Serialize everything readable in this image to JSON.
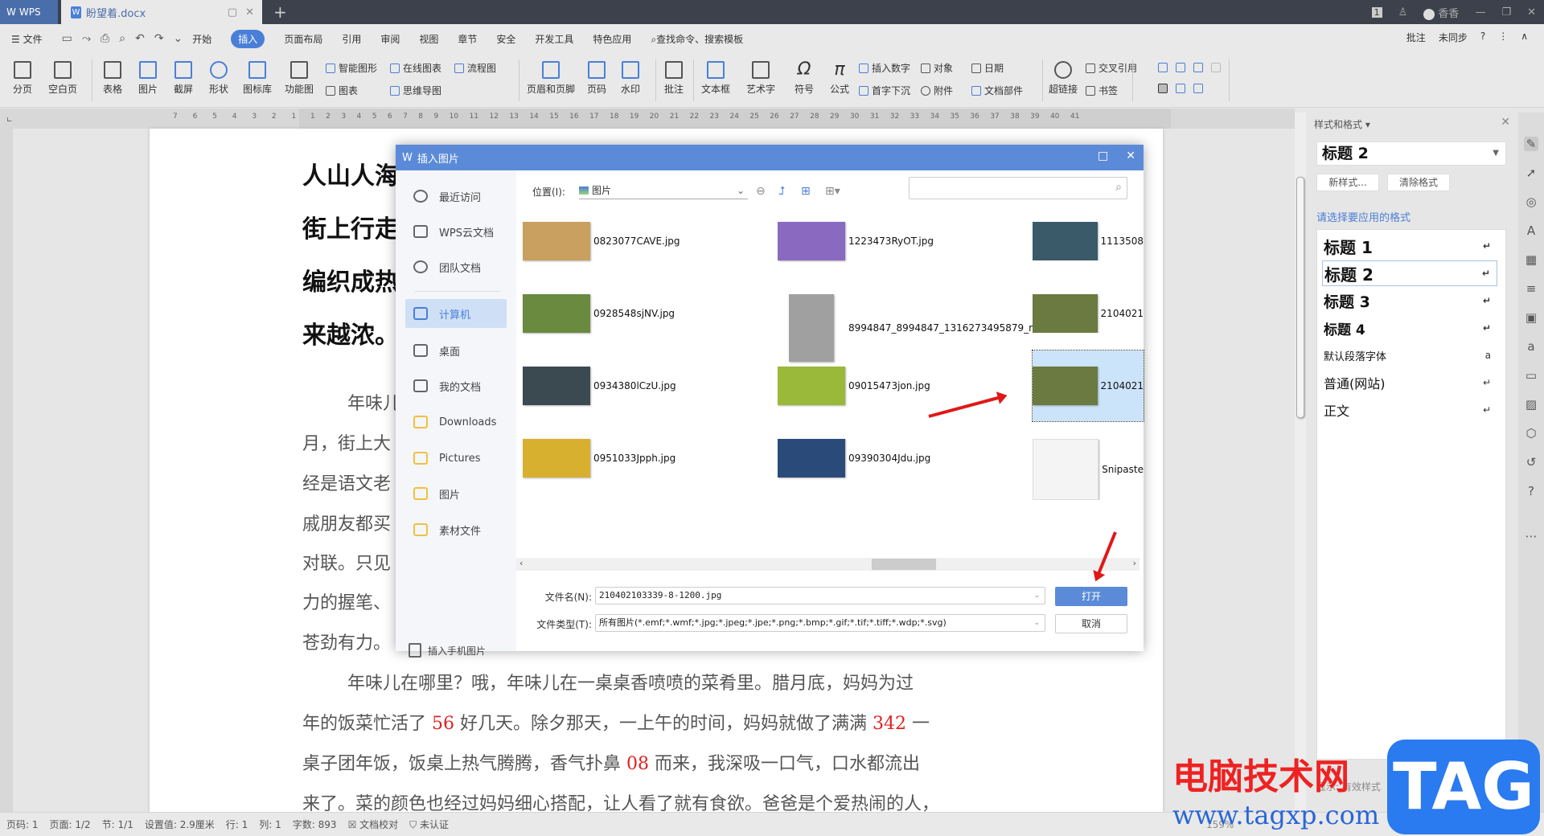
{
  "titlebar": {
    "app_label": "WPS",
    "doc_tab": "盼望着.docx",
    "user_name": "香香",
    "badge": "1"
  },
  "menubar": {
    "file": "文件",
    "tabs": [
      "开始",
      "插入",
      "页面布局",
      "引用",
      "审阅",
      "视图",
      "章节",
      "安全",
      "开发工具",
      "特色应用"
    ],
    "active_tab": "插入",
    "search": "查找命令、搜索模板",
    "right": [
      "批注",
      "未同步",
      "?"
    ]
  },
  "ribbon": {
    "large": [
      "分页",
      "空白页",
      "表格",
      "图片",
      "截屏",
      "形状",
      "图标库",
      "功能图",
      "页眉和页脚",
      "页码",
      "水印",
      "批注",
      "文本框",
      "艺术字",
      "符号",
      "公式",
      "超链接"
    ],
    "small": [
      "智能图形",
      "在线图表",
      "流程图",
      "图表",
      "思维导图",
      "插入数字",
      "对象",
      "日期",
      "首字下沉",
      "附件",
      "文档部件",
      "交叉引用",
      "书签"
    ]
  },
  "ruler": {
    "left_numbers": [
      "7",
      "6",
      "5",
      "4",
      "3",
      "2",
      "1"
    ],
    "right_numbers": [
      "1",
      "2",
      "3",
      "4",
      "5",
      "6",
      "7",
      "8",
      "9",
      "10",
      "11",
      "12",
      "13",
      "14",
      "15",
      "16",
      "17",
      "18",
      "19",
      "20",
      "21",
      "22",
      "23",
      "24",
      "25",
      "26",
      "27",
      "28",
      "29",
      "30",
      "31",
      "32",
      "33",
      "34",
      "35",
      "36",
      "37",
      "38",
      "39",
      "40",
      "41"
    ]
  },
  "document": {
    "headings": [
      "人山人海",
      "街上行走",
      "编织成热",
      "来越浓。"
    ],
    "body_partial": [
      "年味儿",
      "月，街上大",
      "经是语文老",
      "戚朋友都买",
      "对联。只见",
      "力的握笔、",
      "苍劲有力。"
    ],
    "para2": [
      {
        "text": "年味儿在哪里？哦，年味儿在一桌桌香喷喷的菜肴里。腊月底，妈妈为过"
      },
      {
        "pre": "年的饭菜忙活了 ",
        "n1": "56",
        "mid": " 好几天。除夕那天，一上午的时间，妈妈就做了满满 ",
        "n2": "342",
        "post": " 一"
      },
      {
        "pre": "桌子团年饭，饭桌上热气腾腾，香气扑鼻 ",
        "n1": "08",
        "post": " 而来，我深吸一口气，口水都流出"
      },
      {
        "text": "来了。菜的颜色也经过妈妈细心搭配，让人看了就有食欲。爸爸是个爱热闹的人，"
      }
    ]
  },
  "dialog": {
    "title": "插入图片",
    "nav": [
      "最近访问",
      "WPS云文档",
      "团队文档",
      "计算机",
      "桌面",
      "我的文档",
      "Downloads",
      "Pictures",
      "图片",
      "素材文件"
    ],
    "selected_nav": "计算机",
    "insert_phone": "插入手机图片",
    "location_label": "位置(I):",
    "location_value": "图片",
    "search_placeholder": "",
    "files": [
      {
        "name": "0823077CAVE.jpg",
        "color": "#c9a060"
      },
      {
        "name": "1223473RyOT.jpg",
        "color": "#8a6ac0"
      },
      {
        "name": "1113508",
        "color": "#3a5a6a"
      },
      {
        "name": "0928548sjNV.jpg",
        "color": "#6a8a40"
      },
      {
        "name": "8994847_8994847_1316273495879_m...",
        "color": "#a0a0a0"
      },
      {
        "name": "2104021",
        "color": "#6a7a40"
      },
      {
        "name": "0934380lCzU.jpg",
        "color": "#3a4a50"
      },
      {
        "name": "09015473jon.jpg",
        "color": "#9ab83a"
      },
      {
        "name": "2104021",
        "color": "#6a7a40",
        "selected": true
      },
      {
        "name": "0951033Jpph.jpg",
        "color": "#d8b030"
      },
      {
        "name": "09390304Jdu.jpg",
        "color": "#2a4a7a"
      },
      {
        "name": "Snipaste",
        "color": "#f4f4f4"
      }
    ],
    "filename_label": "文件名(N):",
    "filename_value": "210402103339-8-1200.jpg",
    "filetype_label": "文件类型(T):",
    "filetype_value": "所有图片(*.emf;*.wmf;*.jpg;*.jpeg;*.jpe;*.png;*.bmp;*.gif;*.tif;*.tiff;*.wdp;*.svg)",
    "open": "打开",
    "cancel": "取消"
  },
  "stylepane": {
    "title": "样式和格式",
    "current": "标题  2",
    "new_style": "新样式...",
    "clear": "清除格式",
    "hint": "请选择要应用的格式",
    "items": [
      "标题  1",
      "标题  2",
      "标题  3",
      "标题  4",
      "默认段落字体",
      "普通(网站)",
      "正文"
    ],
    "selected": "标题  2",
    "show_label": "显示:",
    "show_value": "有效样式"
  },
  "statusbar": {
    "items": [
      "页码: 1",
      "页面: 1/2",
      "节: 1/1",
      "设置值: 2.9厘米",
      "行: 1",
      "列: 1",
      "字数: 893",
      "文档校对",
      "未认证"
    ],
    "zoom": "159%"
  },
  "watermark": {
    "cn": "电脑技术网",
    "url": "www.tagxp.com",
    "tag": "TAG"
  }
}
